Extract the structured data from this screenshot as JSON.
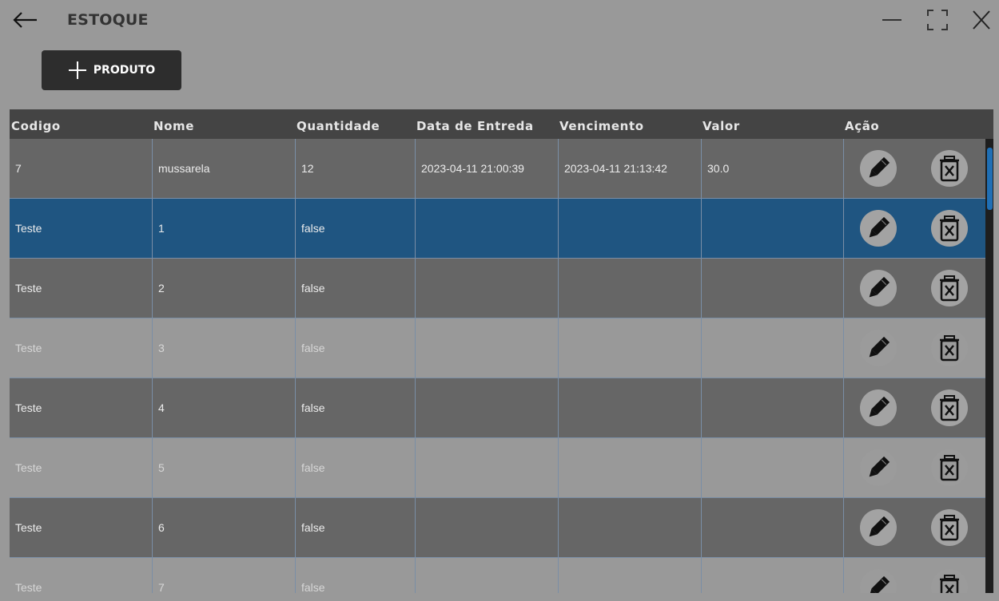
{
  "window": {
    "title": "ESTOQUE"
  },
  "toolbar": {
    "add_product_label": "PRODUTO",
    "add_icon": "plus-icon"
  },
  "table": {
    "columns": [
      "Codigo",
      "Nome",
      "Quantidade",
      "Data de Entreda",
      "Vencimento",
      "Valor",
      "Ação"
    ],
    "rows": [
      {
        "codigo": "7",
        "nome": "mussarela",
        "quantidade": "12",
        "data_entrada": "2023-04-11 21:00:39",
        "vencimento": "2023-04-11 21:13:42",
        "valor": "30.0",
        "style": "dark"
      },
      {
        "codigo": "Teste",
        "nome": "1",
        "quantidade": "false",
        "data_entrada": "",
        "vencimento": "",
        "valor": "",
        "style": "selected"
      },
      {
        "codigo": "Teste",
        "nome": "2",
        "quantidade": "false",
        "data_entrada": "",
        "vencimento": "",
        "valor": "",
        "style": "dark"
      },
      {
        "codigo": "Teste",
        "nome": "3",
        "quantidade": "false",
        "data_entrada": "",
        "vencimento": "",
        "valor": "",
        "style": "light"
      },
      {
        "codigo": "Teste",
        "nome": "4",
        "quantidade": "false",
        "data_entrada": "",
        "vencimento": "",
        "valor": "",
        "style": "dark"
      },
      {
        "codigo": "Teste",
        "nome": "5",
        "quantidade": "false",
        "data_entrada": "",
        "vencimento": "",
        "valor": "",
        "style": "light"
      },
      {
        "codigo": "Teste",
        "nome": "6",
        "quantidade": "false",
        "data_entrada": "",
        "vencimento": "",
        "valor": "",
        "style": "dark"
      },
      {
        "codigo": "Teste",
        "nome": "7",
        "quantidade": "false",
        "data_entrada": "",
        "vencimento": "",
        "valor": "",
        "style": "light"
      }
    ],
    "action_icons": [
      "pencil-icon",
      "trash-icon"
    ]
  },
  "colors": {
    "background": "#999999",
    "header": "#444444",
    "row_dark": "#666666",
    "row_light": "#999999",
    "row_selected": "#1f5581",
    "scroll_thumb": "#1f6fb5"
  }
}
